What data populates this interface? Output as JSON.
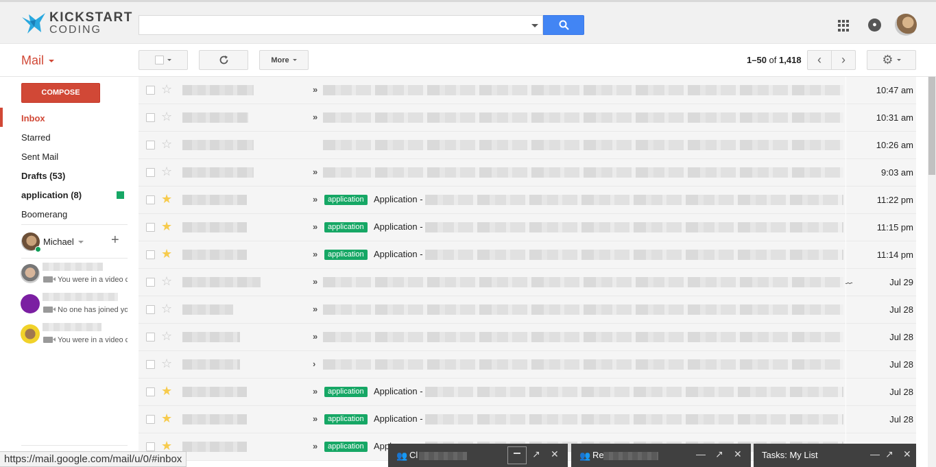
{
  "header": {
    "logo_line1": "KICKSTART",
    "logo_line2": "CODING",
    "search": {
      "value": "",
      "placeholder": ""
    }
  },
  "toolbar": {
    "mail_label": "Mail",
    "more_label": "More",
    "pager": {
      "range": "1–50",
      "of": "of",
      "total": "1,418"
    }
  },
  "sidebar": {
    "compose_label": "COMPOSE",
    "items": [
      {
        "label": "Inbox"
      },
      {
        "label": "Starred"
      },
      {
        "label": "Sent Mail"
      },
      {
        "label": "Drafts (53)"
      },
      {
        "label": "application (8)"
      },
      {
        "label": "Boomerang"
      }
    ],
    "label_color": "#16a765",
    "me_name": "Michael",
    "contacts": [
      {
        "status": "You were in a video c"
      },
      {
        "status": "No one has joined yo"
      },
      {
        "status": "You were in a video c"
      }
    ]
  },
  "emails": [
    {
      "starred": false,
      "marker": "»",
      "tag": "",
      "subject": "",
      "date": "10:47 am",
      "attachment": false
    },
    {
      "starred": false,
      "marker": "»",
      "tag": "",
      "subject": "",
      "date": "10:31 am",
      "attachment": false
    },
    {
      "starred": false,
      "marker": "",
      "tag": "",
      "subject": "",
      "date": "10:26 am",
      "attachment": false
    },
    {
      "starred": false,
      "marker": "»",
      "tag": "",
      "subject": "",
      "date": "9:03 am",
      "attachment": false
    },
    {
      "starred": true,
      "marker": "»",
      "tag": "application",
      "subject": "Application -",
      "date": "11:22 pm",
      "attachment": false
    },
    {
      "starred": true,
      "marker": "»",
      "tag": "application",
      "subject": "Application -",
      "date": "11:15 pm",
      "attachment": false
    },
    {
      "starred": true,
      "marker": "»",
      "tag": "application",
      "subject": "Application -",
      "date": "11:14 pm",
      "attachment": false
    },
    {
      "starred": false,
      "marker": "»",
      "tag": "",
      "subject": "",
      "date": "Jul 29",
      "attachment": true
    },
    {
      "starred": false,
      "marker": "»",
      "tag": "",
      "subject": "",
      "date": "Jul 28",
      "attachment": false
    },
    {
      "starred": false,
      "marker": "»",
      "tag": "",
      "subject": "",
      "date": "Jul 28",
      "attachment": false
    },
    {
      "starred": false,
      "marker": "›",
      "tag": "",
      "subject": "",
      "date": "Jul 28",
      "attachment": false
    },
    {
      "starred": true,
      "marker": "»",
      "tag": "application",
      "subject": "Application -",
      "date": "Jul 28",
      "attachment": false
    },
    {
      "starred": true,
      "marker": "»",
      "tag": "application",
      "subject": "Application -",
      "date": "Jul 28",
      "attachment": false
    },
    {
      "starred": true,
      "marker": "»",
      "tag": "application",
      "subject": "Appl",
      "date": "",
      "attachment": false
    }
  ],
  "statusbar_url": "https://mail.google.com/mail/u/0/#inbox",
  "chat_windows": [
    {
      "title": "Cl"
    },
    {
      "title": "Re"
    }
  ],
  "tasks_title": "Tasks: My List",
  "icons": {
    "search": "search-icon",
    "apps": "apps-grid-icon",
    "notifications": "bell-icon",
    "refresh": "refresh-icon",
    "settings": "gear-icon",
    "star": "star-icon",
    "attachment": "paperclip-icon",
    "video": "video-icon",
    "people": "people-icon"
  },
  "colors": {
    "accent": "#d14836",
    "primary": "#4285f4",
    "label_green": "#16a765",
    "star": "#f7cb4d"
  }
}
